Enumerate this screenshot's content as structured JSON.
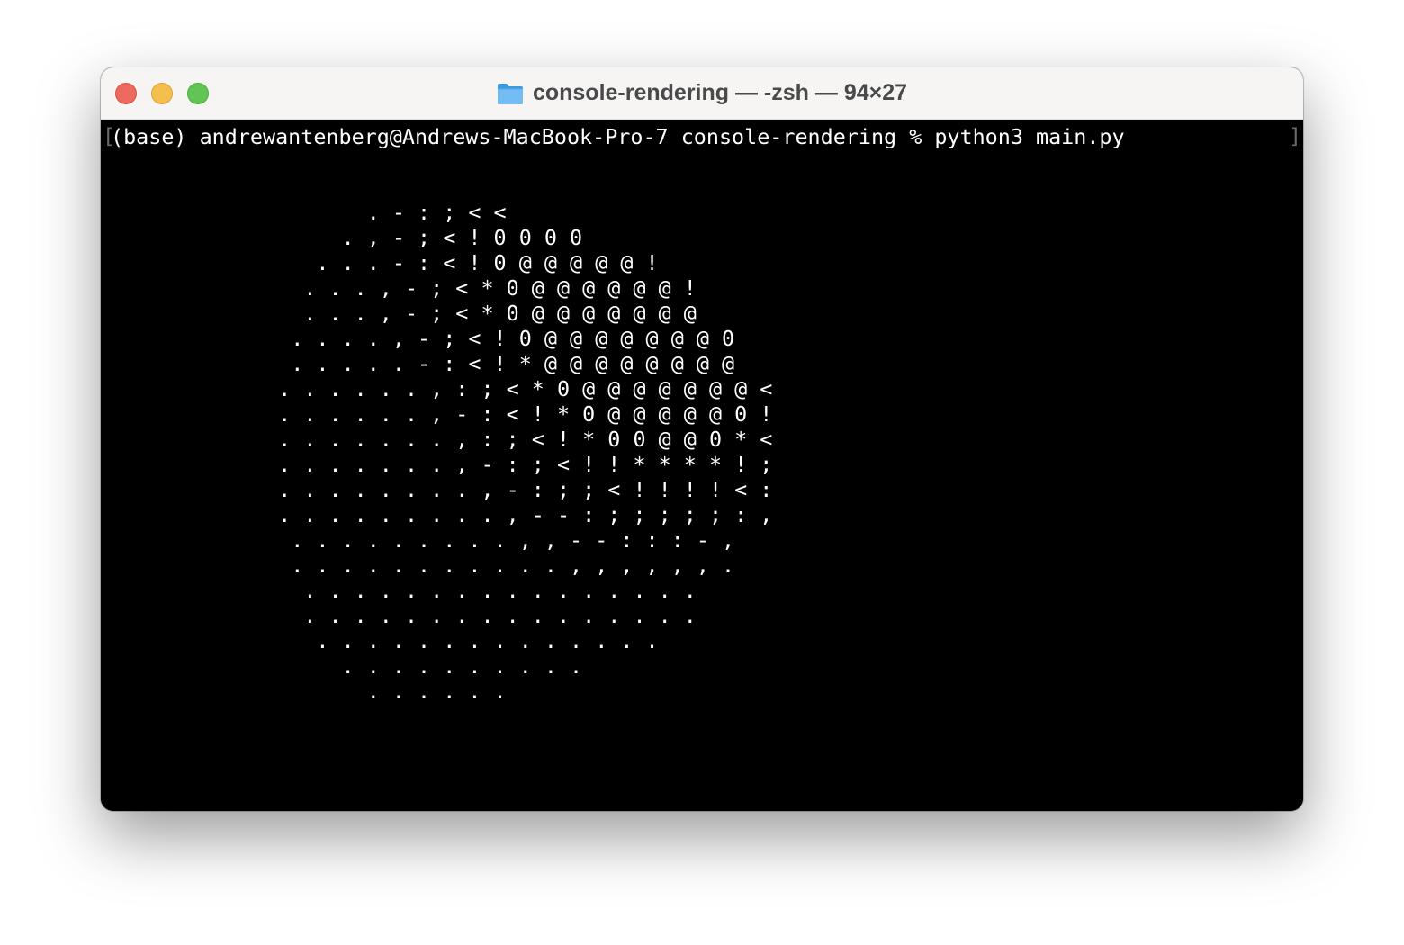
{
  "window": {
    "title": "console-rendering — -zsh — 94×27",
    "folder_icon": "folder-icon",
    "traffic_lights": [
      "close",
      "minimize",
      "zoom"
    ],
    "colors": {
      "close": "#ed6a5e",
      "minimize": "#f5bf4f",
      "zoom": "#61c554",
      "terminal_background": "#000000",
      "terminal_text": "#ffffff"
    }
  },
  "terminal": {
    "prompt_line": "(base) andrewantenberg@Andrews-MacBook-Pro-7 console-rendering % python3 main.py",
    "bracket_left": "[",
    "bracket_right": "]",
    "ascii_render": [
      "                     . - : ; < <",
      "                   . , - ; < ! 0 0 0 0",
      "                 . . . - : < ! 0 @ @ @ @ @ !",
      "                . . . , - ; < * 0 @ @ @ @ @ @ !",
      "                . . . , - ; < * 0 @ @ @ @ @ @ @",
      "               . . . . , - ; < ! 0 @ @ @ @ @ @ @ 0",
      "               . . . . . - : < ! * @ @ @ @ @ @ @ @",
      "              . . . . . . , : ; < * 0 @ @ @ @ @ @ @ <",
      "              . . . . . . , - : < ! * 0 @ @ @ @ @ 0 !",
      "              . . . . . . . , : ; < ! * 0 0 @ @ 0 * <",
      "              . . . . . . . , - : ; < ! ! * * * * ! ;",
      "              . . . . . . . . , - : ; ; < ! ! ! ! < :",
      "              . . . . . . . . . , - - : ; ; ; ; ; : ,",
      "               . . . . . . . . . , , - - : : : - ,",
      "               . . . . . . . . . . . , , , , , , .",
      "                . . . . . . . . . . . . . . . .",
      "                . . . . . . . . . . . . . . . .",
      "                 . . . . . . . . . . . . . .",
      "                   . . . . . . . . . .",
      "                     . . . . . ."
    ]
  }
}
